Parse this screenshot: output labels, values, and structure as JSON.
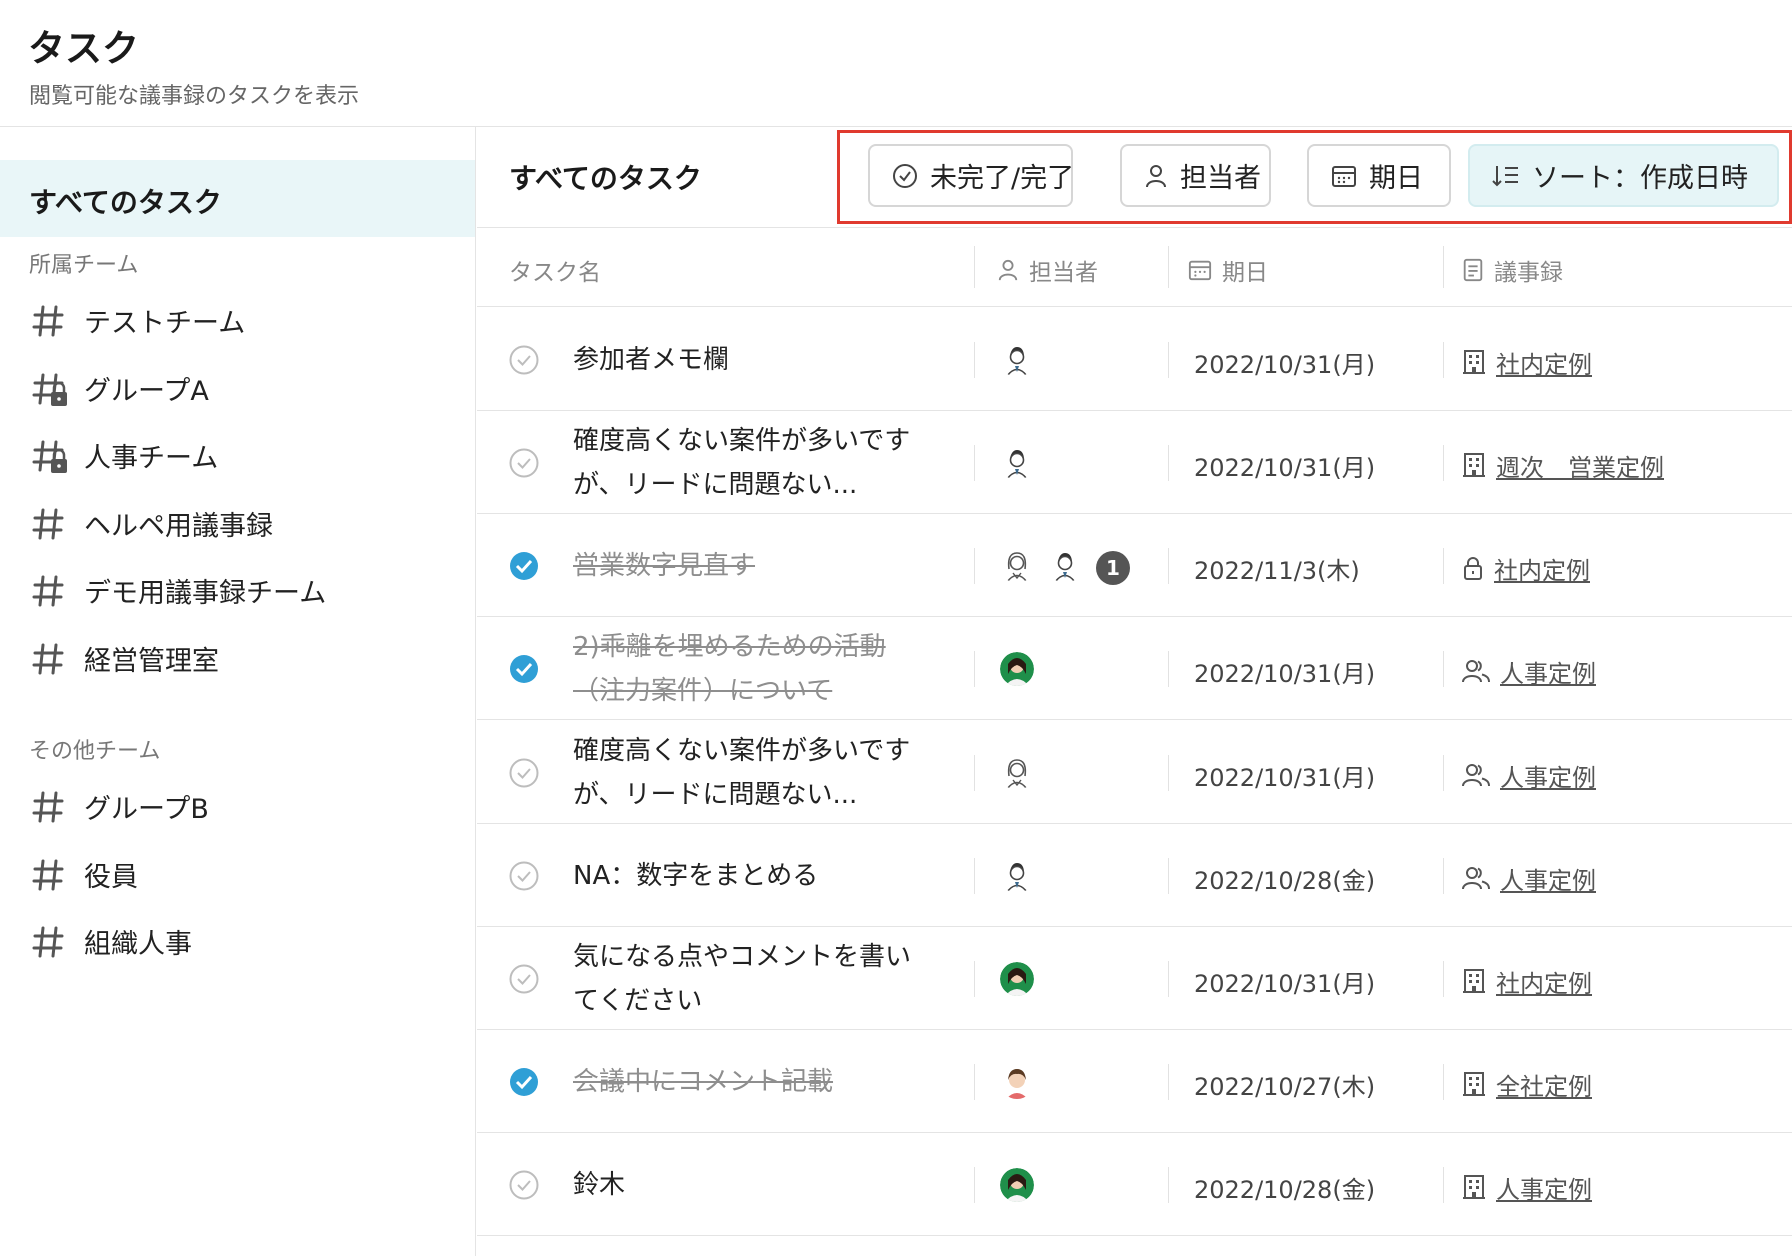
{
  "header": {
    "title": "タスク",
    "subtitle": "閲覧可能な議事録のタスクを表示"
  },
  "sidebar": {
    "active_label": "すべてのタスク",
    "section_own": "所属チーム",
    "section_other": "その他チーム",
    "own_teams": [
      {
        "label": "テストチーム",
        "icon": "hash-icon"
      },
      {
        "label": "グループA",
        "icon": "hash-lock-icon"
      },
      {
        "label": "人事チーム",
        "icon": "hash-lock-icon"
      },
      {
        "label": "ヘルペ用議事録",
        "icon": "hash-icon"
      },
      {
        "label": "デモ用議事録チーム",
        "icon": "hash-icon"
      },
      {
        "label": "経営管理室",
        "icon": "hash-icon"
      }
    ],
    "other_teams": [
      {
        "label": "グループB",
        "icon": "hash-icon"
      },
      {
        "label": "役員",
        "icon": "hash-icon"
      },
      {
        "label": "組織人事",
        "icon": "hash-icon"
      }
    ]
  },
  "main": {
    "title": "すべてのタスク",
    "toolbar": {
      "status_label": "未完了/完了",
      "assignee_label": "担当者",
      "due_label": "期日",
      "sort_label": "ソート：作成日時",
      "highlight_color": "#e03a2f"
    },
    "columns": {
      "task": "タスク名",
      "assignee": "担当者",
      "due": "期日",
      "minutes": "議事録"
    },
    "rows": [
      {
        "task": "参加者メモ欄",
        "done": false,
        "avatars": [
          "male-avatar"
        ],
        "extra_count": "",
        "date": "2022/10/31(月)",
        "minutes_icon": "building-icon",
        "minutes": "社内定例"
      },
      {
        "task": "確度高くない案件が多いですが、リードに問題ない...",
        "done": false,
        "avatars": [
          "male-avatar"
        ],
        "extra_count": "",
        "date": "2022/10/31(月)",
        "minutes_icon": "building-icon",
        "minutes": "週次　営業定例"
      },
      {
        "task": "営業数字見直す",
        "done": true,
        "avatars": [
          "female-avatar",
          "male-avatar"
        ],
        "extra_count": "1",
        "date": "2022/11/3(木)",
        "minutes_icon": "lock-icon",
        "minutes": "社内定例"
      },
      {
        "task": "2)乖離を埋めるための活動（注力案件）について",
        "done": true,
        "avatars": [
          "photo-avatar"
        ],
        "extra_count": "",
        "date": "2022/10/31(月)",
        "minutes_icon": "people-icon",
        "minutes": "人事定例"
      },
      {
        "task": "確度高くない案件が多いですが、リードに問題ない...",
        "done": false,
        "avatars": [
          "female-avatar"
        ],
        "extra_count": "",
        "date": "2022/10/31(月)",
        "minutes_icon": "people-icon",
        "minutes": "人事定例"
      },
      {
        "task": "NA：数字をまとめる",
        "done": false,
        "avatars": [
          "male-avatar"
        ],
        "extra_count": "",
        "date": "2022/10/28(金)",
        "minutes_icon": "people-icon",
        "minutes": "人事定例"
      },
      {
        "task": "気になる点やコメントを書いてください",
        "done": false,
        "avatars": [
          "photo-avatar"
        ],
        "extra_count": "",
        "date": "2022/10/31(月)",
        "minutes_icon": "building-icon",
        "minutes": "社内定例"
      },
      {
        "task": "会議中にコメント記載",
        "done": true,
        "avatars": [
          "girl-avatar"
        ],
        "extra_count": "",
        "date": "2022/10/27(木)",
        "minutes_icon": "building-icon",
        "minutes": "全社定例"
      },
      {
        "task": "鈴木",
        "done": false,
        "avatars": [
          "photo-avatar"
        ],
        "extra_count": "",
        "date": "2022/10/28(金)",
        "minutes_icon": "building-icon",
        "minutes": "人事定例"
      }
    ]
  },
  "colors": {
    "active_bg": "#e9f6f8",
    "check_done": "#2f9fd6",
    "sort_bg": "#e6f5f7"
  }
}
